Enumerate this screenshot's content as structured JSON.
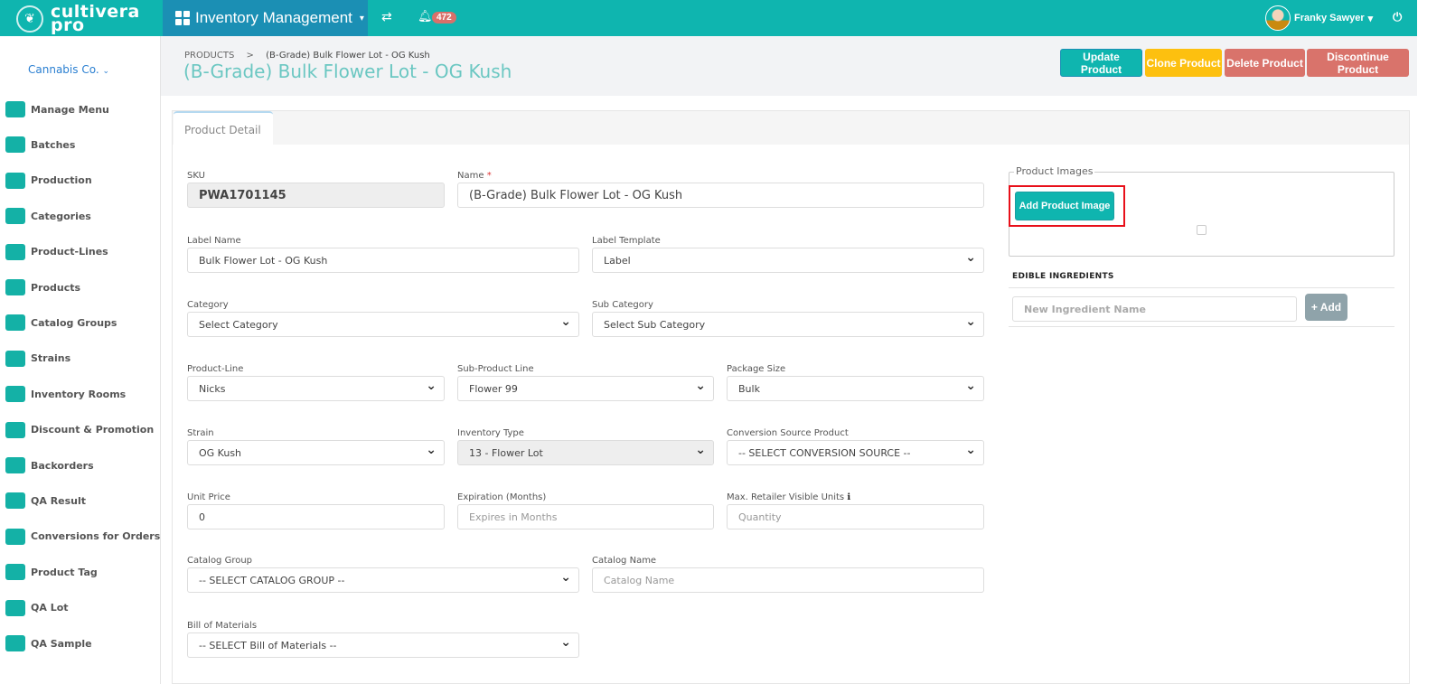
{
  "topbar": {
    "logo_text": "cultivera pro",
    "module": "Inventory Management",
    "notifications_count": "472",
    "user_name": "Franky Sawyer",
    "accent": "#0fb5af"
  },
  "sidebar": {
    "company": "Cannabis Co.",
    "items": [
      {
        "label": "Manage Menu",
        "icon": "menu-book-icon"
      },
      {
        "label": "Batches",
        "icon": "batches-icon"
      },
      {
        "label": "Production",
        "icon": "production-icon"
      },
      {
        "label": "Categories",
        "icon": "table-icon"
      },
      {
        "label": "Product-Lines",
        "icon": "product-lines-icon"
      },
      {
        "label": "Products",
        "icon": "grid-icon"
      },
      {
        "label": "Catalog Groups",
        "icon": "catalog-icon"
      },
      {
        "label": "Strains",
        "icon": "car-icon"
      },
      {
        "label": "Inventory Rooms",
        "icon": "rooms-icon"
      },
      {
        "label": "Discount & Promotion",
        "icon": "tags-icon"
      },
      {
        "label": "Backorders",
        "icon": "backorder-icon"
      },
      {
        "label": "QA Result",
        "icon": "flask-icon"
      },
      {
        "label": "Conversions for Orders",
        "icon": "recycle-icon"
      },
      {
        "label": "Product Tag",
        "icon": "tag-icon"
      },
      {
        "label": "QA Lot",
        "icon": "copy-icon"
      },
      {
        "label": "QA Sample",
        "icon": "flask-icon"
      }
    ]
  },
  "header": {
    "breadcrumb_root": "PRODUCTS",
    "breadcrumb_sep": ">",
    "breadcrumb_current": "(B-Grade) Bulk Flower Lot - OG Kush",
    "title": "(B-Grade) Bulk Flower Lot - OG Kush",
    "buttons": {
      "update": "Update Product",
      "clone": "Clone Product",
      "delete": "Delete Product",
      "discontinue": "Discontinue Product"
    }
  },
  "tab": "Product Detail",
  "form": {
    "sku": {
      "label": "SKU",
      "value": "PWA1701145"
    },
    "name": {
      "label": "Name",
      "required": "*",
      "value": "(B-Grade) Bulk Flower Lot - OG Kush"
    },
    "label_name": {
      "label": "Label Name",
      "value": "Bulk Flower Lot - OG Kush"
    },
    "label_template": {
      "label": "Label Template",
      "value": "Label"
    },
    "category": {
      "label": "Category",
      "value": "Select Category"
    },
    "sub_category": {
      "label": "Sub Category",
      "value": "Select Sub Category"
    },
    "product_line": {
      "label": "Product-Line",
      "value": "Nicks"
    },
    "sub_product_line": {
      "label": "Sub-Product Line",
      "value": "Flower 99"
    },
    "package_size": {
      "label": "Package Size",
      "value": "Bulk"
    },
    "strain": {
      "label": "Strain",
      "value": "OG Kush"
    },
    "inventory_type": {
      "label": "Inventory Type",
      "value": "13 - Flower Lot"
    },
    "conversion_source": {
      "label": "Conversion Source Product",
      "value": "-- SELECT CONVERSION SOURCE --"
    },
    "unit_price": {
      "label": "Unit Price",
      "value": "0"
    },
    "expiration": {
      "label": "Expiration (Months)",
      "placeholder": "Expires in Months"
    },
    "max_units": {
      "label": "Max. Retailer Visible Units",
      "placeholder": "Quantity"
    },
    "catalog_group": {
      "label": "Catalog Group",
      "value": "-- SELECT CATALOG GROUP --"
    },
    "catalog_name": {
      "label": "Catalog Name",
      "placeholder": "Catalog Name"
    },
    "bom": {
      "label": "Bill of Materials",
      "value": "-- SELECT Bill of Materials --"
    }
  },
  "images": {
    "legend": "Product Images",
    "add_button": "Add Product Image"
  },
  "ingredients": {
    "title": "EDIBLE INGREDIENTS",
    "placeholder": "New Ingredient Name",
    "add_button": "+ Add"
  }
}
